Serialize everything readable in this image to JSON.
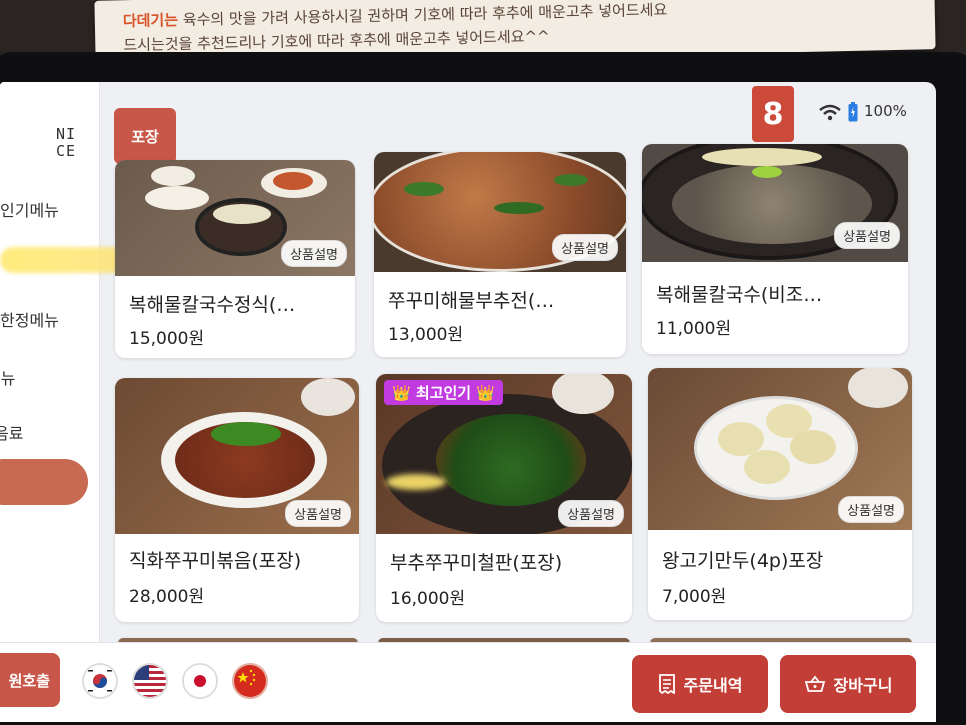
{
  "sign": {
    "line1_red": "다데기는",
    "line1_text": " 육수의 맛을 가려 사용하시길 권하며 기호에 따라 후추에 매운고추 넣어드세요",
    "line2_text": "드시는것을 추천드리나 기호에 따라 후추에 매운고추 넣어드세요^^"
  },
  "status": {
    "table_number": "8",
    "battery": "100%",
    "pack_tag": "포장"
  },
  "sidebar": {
    "logo_line1": "NI",
    "logo_line2": "CE",
    "items": [
      {
        "label": "인기메뉴"
      },
      {
        "label": "한정메뉴"
      },
      {
        "label": "메뉴"
      },
      {
        "label": "음료"
      }
    ]
  },
  "products": [
    {
      "name": "복해물칼국수정식(…",
      "price": "15,000원",
      "desc": "상품설명"
    },
    {
      "name": "쭈꾸미해물부추전(…",
      "price": "13,000원",
      "desc": "상품설명"
    },
    {
      "name": "복해물칼국수(비조…",
      "price": "11,000원",
      "desc": "상품설명"
    },
    {
      "name": "직화쭈꾸미볶음(포장)",
      "price": "28,000원",
      "desc": "상품설명"
    },
    {
      "name": "부추쭈꾸미철판(포장)",
      "price": "16,000원",
      "desc": "상품설명",
      "badge": "최고인기"
    },
    {
      "name": "왕고기만두(4p)포장",
      "price": "7,000원",
      "desc": "상품설명"
    }
  ],
  "bottom": {
    "call_label": "원호출",
    "order_history": "주문내역",
    "cart": "장바구니",
    "languages": [
      "korean-flag",
      "us-flag",
      "japan-flag",
      "china-flag"
    ]
  },
  "colors": {
    "accent": "#c23e36",
    "badge": "#c23be0"
  }
}
